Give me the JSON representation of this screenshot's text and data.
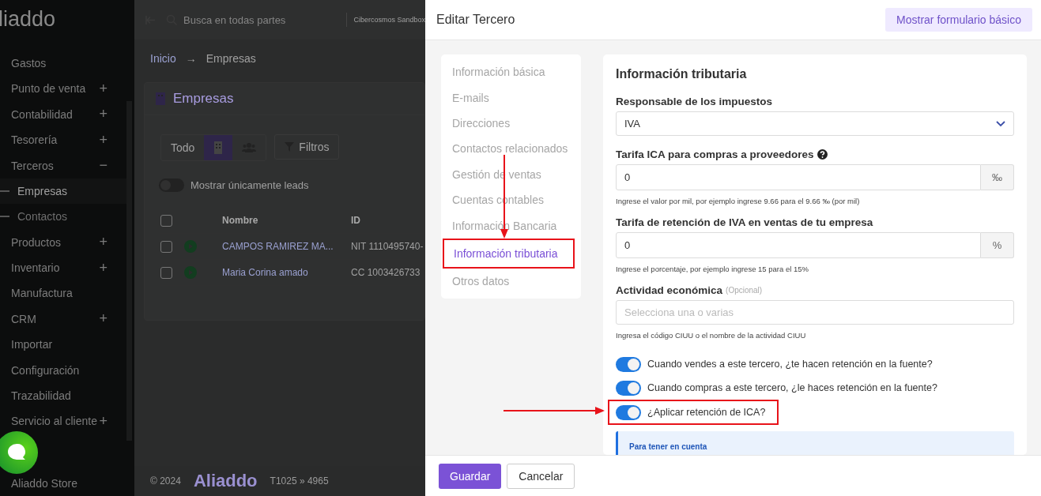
{
  "app": {
    "logo": "liaddo",
    "search": {
      "placeholder": "Busca en todas partes"
    },
    "company": "Cibercosmos Sandbox",
    "sidebar": {
      "items": [
        {
          "label": "Gastos"
        },
        {
          "label": "Punto de venta",
          "expandable": "+"
        },
        {
          "label": "Contabilidad",
          "expandable": "+"
        },
        {
          "label": "Tesorería",
          "expandable": "+"
        },
        {
          "label": "Terceros",
          "expandable": "−",
          "children": [
            {
              "label": "Empresas",
              "selected": true
            },
            {
              "label": "Contactos",
              "selected": false
            }
          ]
        },
        {
          "label": "Productos",
          "expandable": "+"
        },
        {
          "label": "Inventario",
          "expandable": "+"
        },
        {
          "label": "Manufactura"
        },
        {
          "label": "CRM",
          "expandable": "+"
        },
        {
          "label": "Importar"
        },
        {
          "label": "Configuración"
        },
        {
          "label": "Trazabilidad"
        },
        {
          "label": "Servicio al cliente",
          "expandable": "+"
        },
        {
          "label": "Aliaddo Store"
        }
      ]
    },
    "breadcrumb": [
      "Inicio",
      "→",
      "Empresas"
    ],
    "card": {
      "title": "Empresas",
      "segments": [
        {
          "kind": "text",
          "label": "Todo",
          "selected": false
        },
        {
          "kind": "building",
          "selected": true
        },
        {
          "kind": "people",
          "selected": false
        }
      ],
      "filter_button": "Filtros",
      "leads_toggle": {
        "label": "Mostrar únicamente leads",
        "on": false
      },
      "table": {
        "columns": [
          "Nombre",
          "ID"
        ],
        "all_checked": false,
        "rows": [
          {
            "name": "CAMPOS RAMIREZ MA...",
            "id": "NIT 1110495740-",
            "checked": false
          },
          {
            "name": "Maria Corina amado",
            "id": "CC 1003426733",
            "checked": false
          }
        ]
      }
    },
    "footer": {
      "copyright": "© 2024",
      "logo": "Aliaddo",
      "version": "T1025 » 4965"
    }
  },
  "drawer": {
    "title": "Editar Tercero",
    "basic_form_button": "Mostrar formulario básico",
    "nav": [
      {
        "label": "Información básica",
        "selected": false,
        "highlighted": false
      },
      {
        "label": "E-mails",
        "selected": false,
        "highlighted": false
      },
      {
        "label": "Direcciones",
        "selected": false,
        "highlighted": false
      },
      {
        "label": "Contactos relacionados",
        "selected": false,
        "highlighted": false
      },
      {
        "label": "Gestión de ventas",
        "selected": false,
        "highlighted": false
      },
      {
        "label": "Cuentas contables",
        "selected": false,
        "highlighted": false
      },
      {
        "label": "Información Bancaria",
        "selected": false,
        "highlighted": false
      },
      {
        "label": "Información tributaria",
        "selected": true,
        "highlighted": true
      },
      {
        "label": "Otros datos",
        "selected": false,
        "highlighted": false
      }
    ],
    "section_title": "Información tributaria",
    "fields": [
      {
        "kind": "select",
        "label": "Responsable de los impuestos",
        "value": "IVA"
      },
      {
        "kind": "addon",
        "label": "Tarifa ICA para compras a proveedores",
        "help": true,
        "value": "0",
        "addon": "‰",
        "hint": "Ingrese el valor por mil, por ejemplo ingrese 9.66 para el 9.66 ‰ (por mil)"
      },
      {
        "kind": "addon",
        "label": "Tarifa de retención de IVA en ventas de tu empresa",
        "help": false,
        "value": "0",
        "addon": "%",
        "hint": "Ingrese el porcentaje, por ejemplo ingrese 15 para el 15%"
      },
      {
        "kind": "multiselect",
        "label": "Actividad económica",
        "optional": "(Opcional)",
        "placeholder": "Selecciona una o varias",
        "hint": "Ingresa el código CIUU o el nombre de la actividad CIUU"
      }
    ],
    "toggles": [
      {
        "label": "Cuando vendes a este tercero, ¿te hacen retención en la fuente?",
        "on": true,
        "highlighted": false
      },
      {
        "label": "Cuando compras a este tercero, ¿le haces retención en la fuente?",
        "on": true,
        "highlighted": false
      },
      {
        "label": "¿Aplicar retención de ICA?",
        "on": true,
        "highlighted": true
      }
    ],
    "notice": {
      "title": "Para tener en cuenta"
    },
    "buttons": [
      {
        "label": "Guardar",
        "kind": "primary"
      },
      {
        "label": "Cancelar",
        "kind": "secondary"
      }
    ]
  }
}
